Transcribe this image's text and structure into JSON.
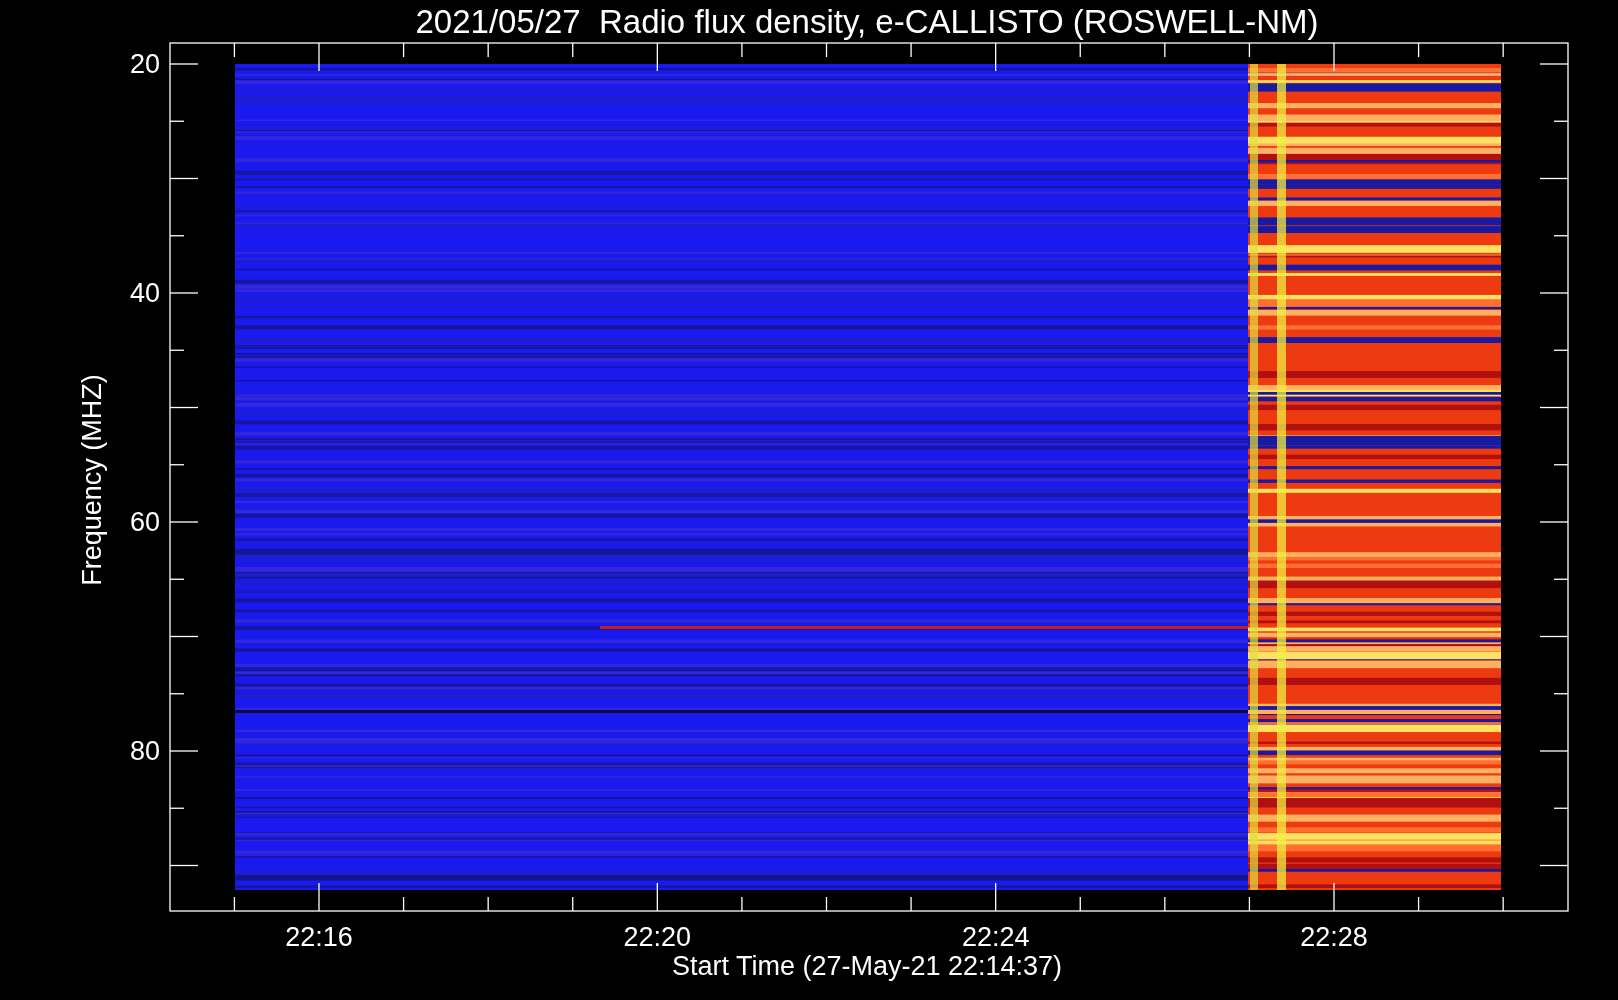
{
  "plot": {
    "title": "2021/05/27  Radio flux density, e-CALLISTO (ROSWELL-NM)",
    "y_axis": {
      "label": "Frequency (MHZ)",
      "ticks": [
        "20",
        "40",
        "60",
        "80"
      ]
    },
    "x_axis": {
      "label": "Start Time (27-May-21 22:14:37)",
      "ticks": [
        "22:16",
        "22:20",
        "22:24",
        "22:28"
      ]
    }
  }
}
